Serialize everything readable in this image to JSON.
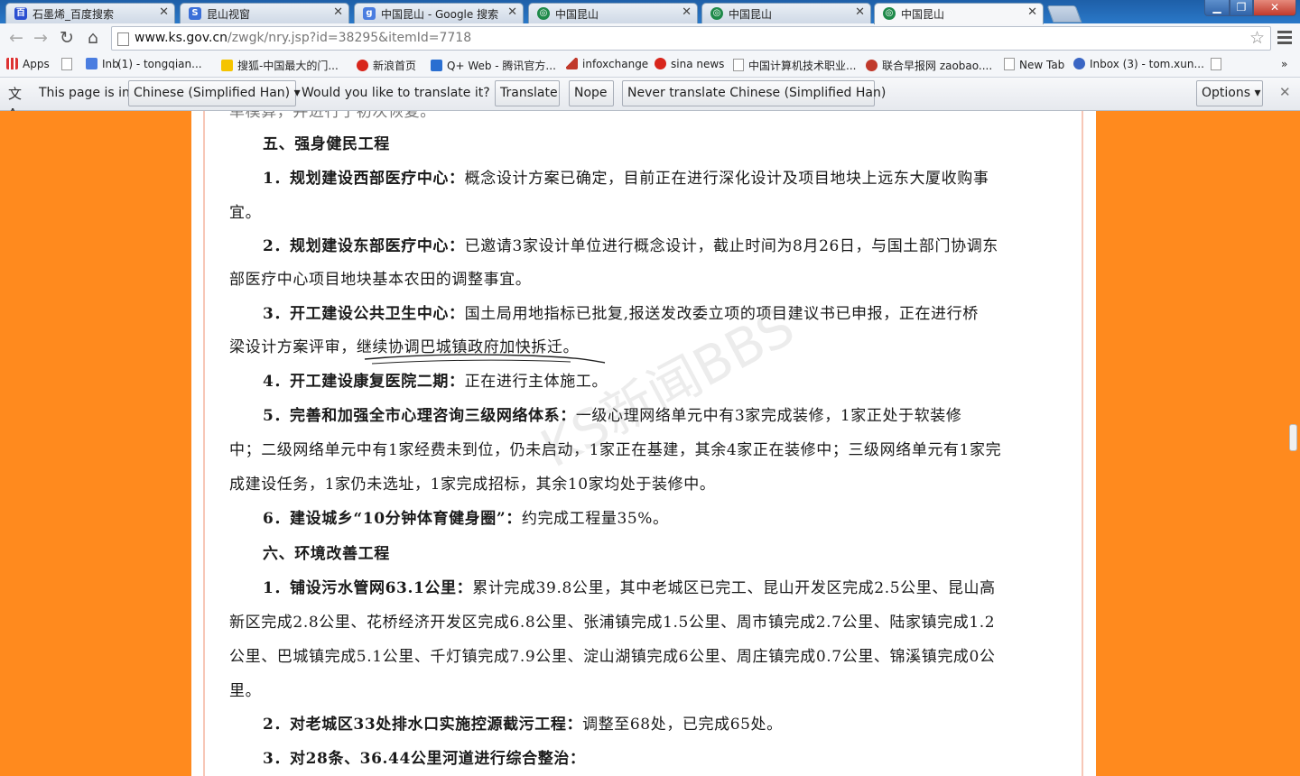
{
  "browser": {
    "tabs": [
      {
        "title": "石墨烯_百度搜索",
        "favicon": "baidu-favicon",
        "color": "#2b4fd1"
      },
      {
        "title": "昆山视窗",
        "favicon": "s-favicon",
        "color": "#3b6fd8"
      },
      {
        "title": "中国昆山 - Google 搜索",
        "favicon": "google-favicon",
        "color": "#4a7de0"
      },
      {
        "title": "中国昆山",
        "favicon": "ks-favicon",
        "color": "#1f8a4a"
      },
      {
        "title": "中国昆山",
        "favicon": "ks-favicon",
        "color": "#1f8a4a"
      },
      {
        "title": "中国昆山",
        "favicon": "ks-favicon",
        "color": "#1f8a4a",
        "active": true
      }
    ],
    "url_domain": "www.ks.gov.cn",
    "url_path": "/zwgk/nry.jsp?id=38295&itemId=7718",
    "bookmarks": [
      {
        "label": "Apps",
        "icon": "apps-icon"
      },
      {
        "label": "",
        "icon": "page-icon"
      },
      {
        "label": "Inb",
        "icon": "g-icon"
      },
      {
        "label": "(1) - tongqian...",
        "icon": "page-icon"
      },
      {
        "label": "搜狐-中国最大的门...",
        "icon": "sohu-icon"
      },
      {
        "label": "新浪首页",
        "icon": "sina-icon"
      },
      {
        "label": "Q+ Web - 腾讯官方...",
        "icon": "qq-icon"
      },
      {
        "label": "infoxchange",
        "icon": "triangle-icon"
      },
      {
        "label": "sina news",
        "icon": "sina-icon"
      },
      {
        "label": "中国计算机技术职业...",
        "icon": "page-icon"
      },
      {
        "label": "联合早报网 zaobao....",
        "icon": "zaobao-icon"
      },
      {
        "label": "New Tab",
        "icon": "page-icon"
      },
      {
        "label": "Inbox (3) - tom.xun...",
        "icon": "mail-icon"
      },
      {
        "label": "",
        "icon": "page-icon"
      },
      {
        "label": "»",
        "icon": ""
      }
    ]
  },
  "translate_bar": {
    "prefix": "This page is in",
    "language": "Chinese (Simplified Han)",
    "question": "Would you like to translate it?",
    "translate": "Translate",
    "nope": "Nope",
    "never": "Never translate Chinese (Simplified Han)",
    "options": "Options"
  },
  "article": {
    "cut_top": "单模算，并进行了初次恢复。",
    "h5": "五、强身健民工程",
    "p1_lead": "1．规划建设西部医疗中心：",
    "p1_a": "概念设计方案已确定，目前正在进行深化设计及项目地块上远东大厦收购事",
    "p1_b": "宜。",
    "p2_lead": "2．规划建设东部医疗中心：",
    "p2_a": "已邀请3家设计单位进行概念设计，截止时间为8月26日，与国土部门协调东",
    "p2_b": "部医疗中心项目地块基本农田的调整事宜。",
    "p3_lead": "3．开工建设公共卫生中心：",
    "p3_a": "国土局用地指标已批复,报送发改委立项的项目建议书已申报，正在进行桥",
    "p3_b1": "梁设计方案评审，",
    "p3_b2": "继续协调巴城镇政府加快拆迁。",
    "p4_lead": "4．开工建设康复医院二期：",
    "p4_a": "正在进行主体施工。",
    "p5_lead": "5．完善和加强全市心理咨询三级网络体系：",
    "p5_a": "一级心理网络单元中有3家完成装修，1家正处于软装修",
    "p5_b": "中；二级网络单元中有1家经费未到位，仍未启动，1家正在基建，其余4家正在装修中；三级网络单元有1家完",
    "p5_c": "成建设任务，1家仍未选址，1家完成招标，其余10家均处于装修中。",
    "p6_lead": "6．建设城乡“10分钟体育健身圈”：",
    "p6_a": "约完成工程量35%。",
    "h6": "六、环境改善工程",
    "q1_lead": "1．铺设污水管网63.1公里：",
    "q1_a": "累计完成39.8公里，其中老城区已完工、昆山开发区完成2.5公里、昆山高",
    "q1_b": "新区完成2.8公里、花桥经济开发区完成6.8公里、张浦镇完成1.5公里、周市镇完成2.7公里、陆家镇完成1.2",
    "q1_c": "公里、巴城镇完成5.1公里、千灯镇完成7.9公里、淀山湖镇完成6公里、周庄镇完成0.7公里、锦溪镇完成0公",
    "q1_d": "里。",
    "q2_lead": "2．对老城区33处排水口实施控源截污工程：",
    "q2_a": "调整至68处，已完成65处。",
    "q3_lead": "3．对28条、36.44公里河道进行综合整治：",
    "watermark": "KS新闻BBS"
  }
}
